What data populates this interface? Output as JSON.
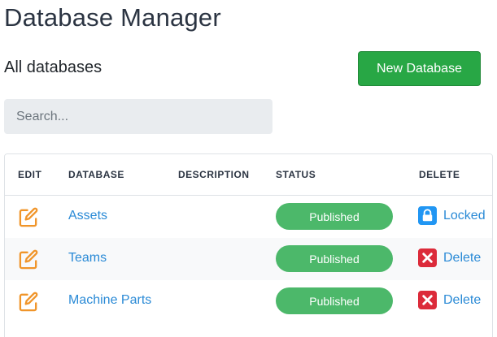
{
  "header": {
    "title": "Database Manager",
    "subtitle": "All databases",
    "new_button_label": "New Database"
  },
  "search": {
    "placeholder": "Search...",
    "value": ""
  },
  "table": {
    "columns": [
      "EDIT",
      "DATABASE",
      "DESCRIPTION",
      "STATUS",
      "DELETE"
    ],
    "rows": [
      {
        "name": "Assets",
        "description": "",
        "status": "Published",
        "action": "Locked",
        "action_icon": "lock-icon"
      },
      {
        "name": "Teams",
        "description": "",
        "status": "Published",
        "action": "Delete",
        "action_icon": "delete-x-icon"
      },
      {
        "name": "Machine Parts",
        "description": "",
        "status": "Published",
        "action": "Delete",
        "action_icon": "delete-x-icon"
      }
    ]
  },
  "colors": {
    "primary_button": "#28a745",
    "status_badge": "#4cb86a",
    "link": "#2a8ad6",
    "edit_icon": "#f0952a",
    "lock_icon": "#2196f3",
    "delete_icon": "#dc2b3a"
  }
}
